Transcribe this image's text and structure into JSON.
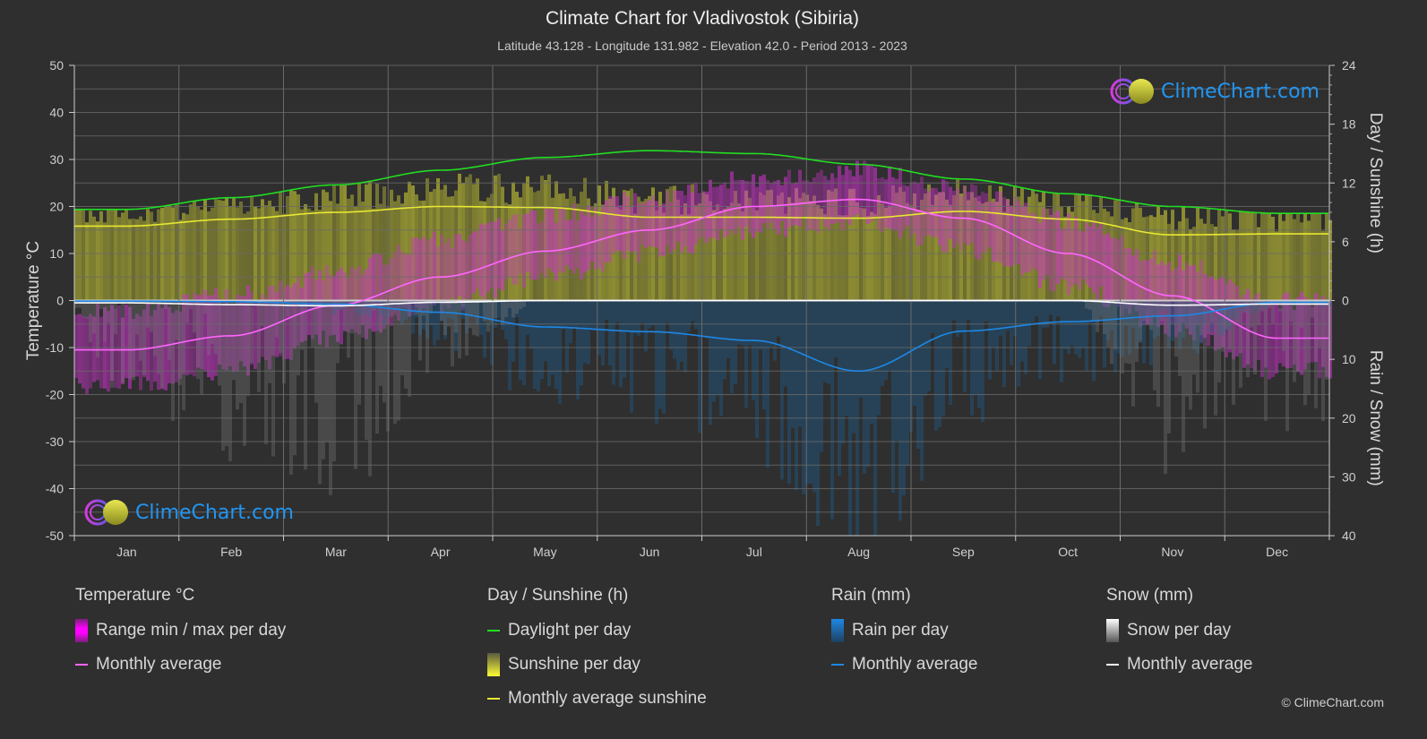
{
  "header": {
    "title": "Climate Chart for Vladivostok (Sibiria)",
    "subtitle": "Latitude 43.128 - Longitude 131.982 - Elevation 42.0 - Period 2013 - 2023"
  },
  "logo": {
    "text": "ClimeChart.com"
  },
  "copyright": "© ClimeChart.com",
  "legend": {
    "temperature": {
      "title": "Temperature °C",
      "range_label": "Range min / max per day",
      "avg_label": "Monthly average"
    },
    "sunshine": {
      "title": "Day / Sunshine (h)",
      "daylight_label": "Daylight per day",
      "sunshine_label": "Sunshine per day",
      "avg_label": "Monthly average sunshine"
    },
    "rain": {
      "title": "Rain (mm)",
      "per_day_label": "Rain per day",
      "avg_label": "Monthly average"
    },
    "snow": {
      "title": "Snow (mm)",
      "per_day_label": "Snow per day",
      "avg_label": "Monthly average"
    }
  },
  "colors": {
    "temperature": "#ff66ff",
    "temperature_range": "#cc33cc",
    "daylight": "#22dd22",
    "sunshine": "#e8e833",
    "sunshine_fill": "#9a9a33",
    "rain": "#1e88e5",
    "snow": "#ffffff",
    "background": "#2f2f2f",
    "grid": "#5a5a5a"
  },
  "chart_data": {
    "type": "line",
    "title": "Climate Chart for Vladivostok (Sibiria)",
    "categories": [
      "Jan",
      "Feb",
      "Mar",
      "Apr",
      "May",
      "Jun",
      "Jul",
      "Aug",
      "Sep",
      "Oct",
      "Nov",
      "Dec"
    ],
    "axes": {
      "left": {
        "label": "Temperature °C",
        "range": [
          -50,
          50
        ],
        "ticks": [
          "50",
          "40",
          "30",
          "20",
          "10",
          "0",
          "-10",
          "-20",
          "-30",
          "-40",
          "-50"
        ]
      },
      "right_top": {
        "label": "Day / Sunshine (h)",
        "range": [
          0,
          24
        ],
        "ticks": [
          "24",
          "18",
          "12",
          "6",
          "0"
        ]
      },
      "right_bottom": {
        "label": "Rain / Snow (mm)",
        "range": [
          0,
          40
        ],
        "ticks": [
          "0",
          "10",
          "20",
          "30",
          "40"
        ]
      }
    },
    "grid": true,
    "series": [
      {
        "name": "Temperature monthly average",
        "unit": "°C",
        "axis": "left",
        "values": [
          -10.5,
          -7.5,
          -1.0,
          5.0,
          10.5,
          15.0,
          20.0,
          21.5,
          17.5,
          10.0,
          1.0,
          -8.0
        ]
      },
      {
        "name": "Daylight per day",
        "unit": "h",
        "axis": "right_top",
        "values": [
          9.3,
          10.5,
          11.8,
          13.3,
          14.6,
          15.3,
          15.0,
          13.9,
          12.4,
          10.9,
          9.6,
          8.9
        ]
      },
      {
        "name": "Monthly average sunshine",
        "unit": "h",
        "axis": "right_top",
        "values": [
          7.6,
          8.3,
          9.0,
          9.6,
          9.5,
          8.5,
          8.5,
          8.4,
          9.1,
          8.3,
          6.7,
          6.8
        ]
      },
      {
        "name": "Rain monthly average",
        "unit": "mm",
        "axis": "right_bottom",
        "values": [
          0.1,
          0.2,
          0.6,
          2.0,
          4.5,
          5.3,
          6.8,
          12.0,
          5.2,
          3.6,
          2.6,
          0.3
        ]
      },
      {
        "name": "Snow monthly average",
        "unit": "mm",
        "axis": "right_bottom",
        "values": [
          0.4,
          0.7,
          0.9,
          0.3,
          0.0,
          0.0,
          0.0,
          0.0,
          0.0,
          0.0,
          0.8,
          0.6
        ]
      }
    ],
    "temperature_range_approx": {
      "min": [
        -16,
        -13,
        -6,
        1,
        7,
        12,
        17,
        19,
        13,
        5,
        -4,
        -13
      ],
      "max": [
        -4,
        -1,
        4,
        11,
        16,
        20,
        24,
        26,
        22,
        15,
        6,
        -2
      ]
    }
  }
}
